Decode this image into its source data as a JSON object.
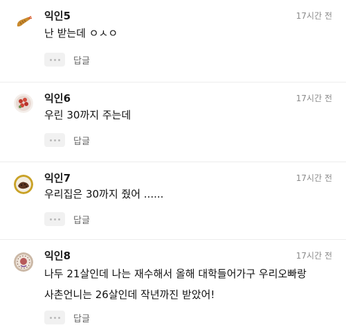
{
  "comments": [
    {
      "author": "익인5",
      "time": "17시간 전",
      "lines": [
        "난 받는데 ㅇㅅㅇ"
      ],
      "reply_label": "답글",
      "avatar_icon": "fried-shrimp-icon"
    },
    {
      "author": "익인6",
      "time": "17시간 전",
      "lines": [
        "우린 30까지 주는데"
      ],
      "reply_label": "답글",
      "avatar_icon": "berry-wreath-icon"
    },
    {
      "author": "익인7",
      "time": "17시간 전",
      "lines": [
        "우리집은 30까지 줬어 ......"
      ],
      "reply_label": "답글",
      "avatar_icon": "cookie-plate-icon"
    },
    {
      "author": "익인8",
      "time": "17시간 전",
      "lines": [
        "나두 21살인데 나는 재수해서 올해 대학들어가구 우리오빠랑",
        "사촌언니는 26살인데 작년까진 받았어!"
      ],
      "reply_label": "답글",
      "avatar_icon": "sticker-seal-icon"
    }
  ]
}
